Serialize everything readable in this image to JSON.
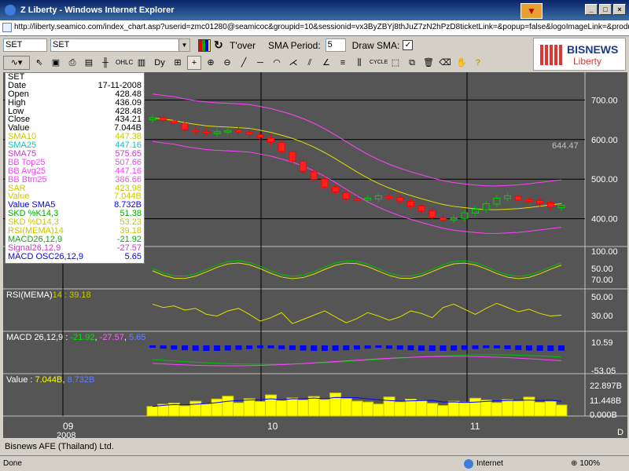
{
  "window": {
    "title": "Z Liberty - Windows Internet Explorer",
    "address": "http://liberty.seamico.com/index_chart.asp?userid=zmc01280@seamicoc&groupid=10&sessionid=vx3ByZBYj8thJuZ7zN2hPzD8ticketLink=&popup=false&logoImageLink=&productImageLink=images/si"
  },
  "toolbar": {
    "symbol_box": "SET",
    "symbol_select": "SET",
    "tover_label": "T'over",
    "sma_period_label": "SMA Period:",
    "sma_period_value": "5",
    "draw_sma_label": "Draw SMA:",
    "draw_sma_checked": "✓"
  },
  "logo": {
    "brand": "BISNEWS",
    "sub": "Liberty",
    "accent": "#e3342f"
  },
  "info": [
    {
      "label": "SET",
      "value": "",
      "color": "#000000"
    },
    {
      "label": "Date",
      "value": "17-11-2008",
      "color": "#000000"
    },
    {
      "label": "Open",
      "value": "428.48",
      "color": "#000000"
    },
    {
      "label": "High",
      "value": "436.09",
      "color": "#000000"
    },
    {
      "label": "Low",
      "value": "428.48",
      "color": "#000000"
    },
    {
      "label": "Close",
      "value": "434.21",
      "color": "#000000"
    },
    {
      "label": "Value",
      "value": "7.044B",
      "color": "#000000"
    },
    {
      "label": "SMA10",
      "value": "447.38",
      "color": "#c8c800"
    },
    {
      "label": "SMA25",
      "value": "447.16",
      "color": "#00c8c8"
    },
    {
      "label": "SMA75",
      "value": "575.65",
      "color": "#c040c0"
    },
    {
      "label": "BB Top25",
      "value": "507.66",
      "color": "#ff40ff"
    },
    {
      "label": "BB Avg25",
      "value": "447.16",
      "color": "#ff40ff"
    },
    {
      "label": "BB Btm25",
      "value": "386.66",
      "color": "#ff40ff"
    },
    {
      "label": "SAR",
      "value": "423.98",
      "color": "#c8c800"
    },
    {
      "label": "Value",
      "value": "7.044B",
      "color": "#c8c800"
    },
    {
      "label": "Value SMA5",
      "value": "8.732B",
      "color": "#0000ff"
    },
    {
      "label": "SKD %K14,3",
      "value": "51.38",
      "color": "#00b000"
    },
    {
      "label": "SKD %D14,3",
      "value": "53.23",
      "color": "#c8c800"
    },
    {
      "label": "RSI(MEMA)14",
      "value": "39.18",
      "color": "#c8c800"
    },
    {
      "label": "MACD26,12,9",
      "value": "-21.92",
      "color": "#00b000"
    },
    {
      "label": "Signal26,12,9",
      "value": "-27.57",
      "color": "#c040c0"
    },
    {
      "label": "MACD OSC26,12,9",
      "value": "5.65",
      "color": "#0000ff"
    }
  ],
  "panels": {
    "rsi_label": "RSI(MEMA)",
    "rsi_params": "14 :",
    "rsi_value": "39.18",
    "macd_label": "MACD 26,12,9 :",
    "macd_value": "-21.92",
    "macd_signal": "-27.57",
    "macd_osc": "5.65",
    "vol_label": "Value :",
    "vol_value": "7.044B",
    "vol_sma": "8.732B",
    "price_marker": "644.47"
  },
  "axis": {
    "price_ticks": [
      "700.00",
      "600.00",
      "500.00",
      "400.00"
    ],
    "skd_ticks": [
      "100.00",
      "50.00",
      "70.00"
    ],
    "rsi_ticks": [
      "50.00",
      "30.00"
    ],
    "macd_ticks": [
      "10.59",
      "-53.05"
    ],
    "vol_ticks": [
      "22.897B",
      "11.448B",
      "0.000B"
    ],
    "x_labels": [
      "09",
      "10",
      "11"
    ],
    "x_sub": "2008",
    "corner": "D"
  },
  "footer": {
    "company": "Bisnews AFE (Thailand) Ltd.",
    "status_left": "Done",
    "status_zone": "Internet",
    "zoom": "100%"
  },
  "chart_data": {
    "type": "candlestick",
    "title": "SET",
    "x_ticks": [
      "09",
      "10",
      "11"
    ],
    "ylim": [
      330,
      770
    ],
    "closes": [
      655,
      648,
      642,
      625,
      622,
      617,
      620,
      623,
      619,
      613,
      606,
      594,
      570,
      546,
      520,
      500,
      480,
      468,
      450,
      447,
      452,
      458,
      455,
      445,
      432,
      420,
      404,
      397,
      402,
      415,
      424,
      438,
      452,
      458,
      447,
      446,
      439,
      430,
      434
    ],
    "opens": [
      650,
      655,
      647,
      640,
      624,
      620,
      615,
      621,
      624,
      618,
      612,
      604,
      592,
      569,
      545,
      519,
      500,
      480,
      466,
      450,
      447,
      450,
      456,
      454,
      444,
      432,
      420,
      403,
      397,
      401,
      414,
      423,
      437,
      451,
      457,
      448,
      446,
      440,
      428
    ],
    "volume": [
      6.1,
      7.5,
      8.2,
      6.5,
      9.4,
      7.8,
      10.8,
      12.6,
      8.4,
      11.0,
      9.2,
      13.4,
      9.8,
      11.5,
      10.2,
      12.4,
      10.5,
      14.6,
      11.1,
      9.5,
      8.9,
      7.6,
      12.1,
      9.0,
      10.7,
      9.9,
      8.1,
      6.7,
      9.4,
      8.8,
      11.3,
      10.1,
      8.5,
      10.4,
      9.6,
      12.0,
      8.7,
      9.3,
      7.0
    ],
    "rsi": [
      52,
      48,
      50,
      45,
      47,
      40,
      38,
      44,
      47,
      40,
      32,
      36,
      42,
      29,
      34,
      39,
      44,
      37,
      30,
      35,
      42,
      38,
      33,
      37,
      44,
      41,
      36,
      48,
      52,
      46,
      40,
      47,
      53,
      48,
      43,
      46,
      41,
      38,
      39
    ]
  }
}
